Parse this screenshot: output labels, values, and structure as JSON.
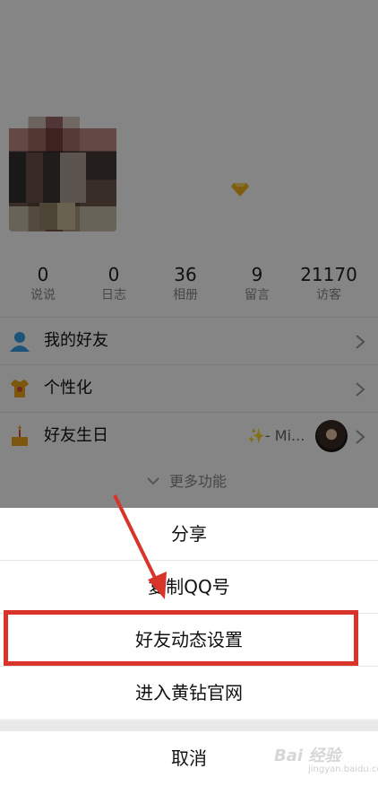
{
  "stats": [
    {
      "value": "0",
      "label": "说说"
    },
    {
      "value": "0",
      "label": "日志"
    },
    {
      "value": "36",
      "label": "相册"
    },
    {
      "value": "9",
      "label": "留言"
    },
    {
      "value": "21170",
      "label": "访客"
    }
  ],
  "menu": [
    {
      "label": "我的好友",
      "icon": "user-icon"
    },
    {
      "label": "个性化",
      "icon": "shirt-icon"
    },
    {
      "label": "好友生日",
      "icon": "cake-icon",
      "extra": "✨- Mi..."
    }
  ],
  "more_label": "更多功能",
  "sheet": {
    "items": [
      {
        "label": "分享"
      },
      {
        "label": "复制QQ号"
      },
      {
        "label": "好友动态设置",
        "highlighted": true
      },
      {
        "label": "进入黄钻官网"
      }
    ],
    "cancel": "取消"
  },
  "watermark": {
    "brand": "Bai 经验",
    "sub": "jingyan.baidu.com"
  },
  "colors": {
    "accent_highlight": "#d8342a",
    "vip_gold": "#f2b51c",
    "friend_blue": "#3aa0e8"
  }
}
